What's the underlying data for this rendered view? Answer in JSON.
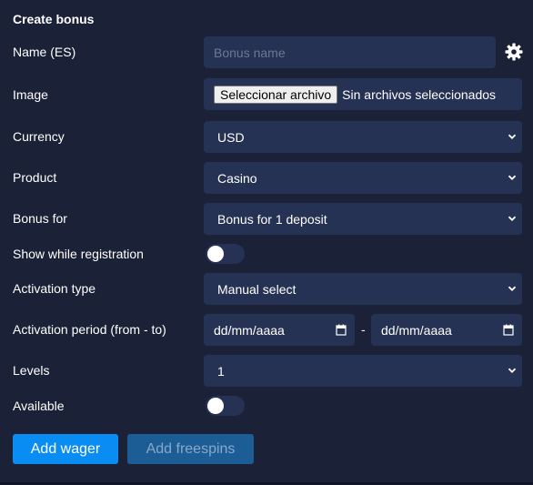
{
  "title": "Create bonus",
  "labels": {
    "name": "Name (ES)",
    "image": "Image",
    "currency": "Currency",
    "product": "Product",
    "bonus_for": "Bonus for",
    "show_registration": "Show while registration",
    "activation_type": "Activation type",
    "activation_period": "Activation period (from - to)",
    "levels": "Levels",
    "available": "Available"
  },
  "name_input": {
    "placeholder": "Bonus name"
  },
  "image_input": {
    "button": "Seleccionar archivo",
    "status": "Sin archivos seleccionados"
  },
  "selects": {
    "currency": "USD",
    "product": "Casino",
    "bonus_for": "Bonus for 1 deposit",
    "activation_type": "Manual select",
    "levels": "1"
  },
  "toggles": {
    "show_registration": false,
    "available": false
  },
  "period": {
    "from": "dd/mm/aaaa",
    "to": "dd/mm/aaaa",
    "separator": "-"
  },
  "buttons": {
    "add_wager": "Add wager",
    "add_freespins": "Add freespins"
  },
  "colors": {
    "background": "#1b2238",
    "field": "#263253",
    "primary": "#0a8df3",
    "secondary": "#1c5d96"
  },
  "icons": [
    "gear-icon",
    "chevron-down-icon",
    "calendar-icon"
  ]
}
